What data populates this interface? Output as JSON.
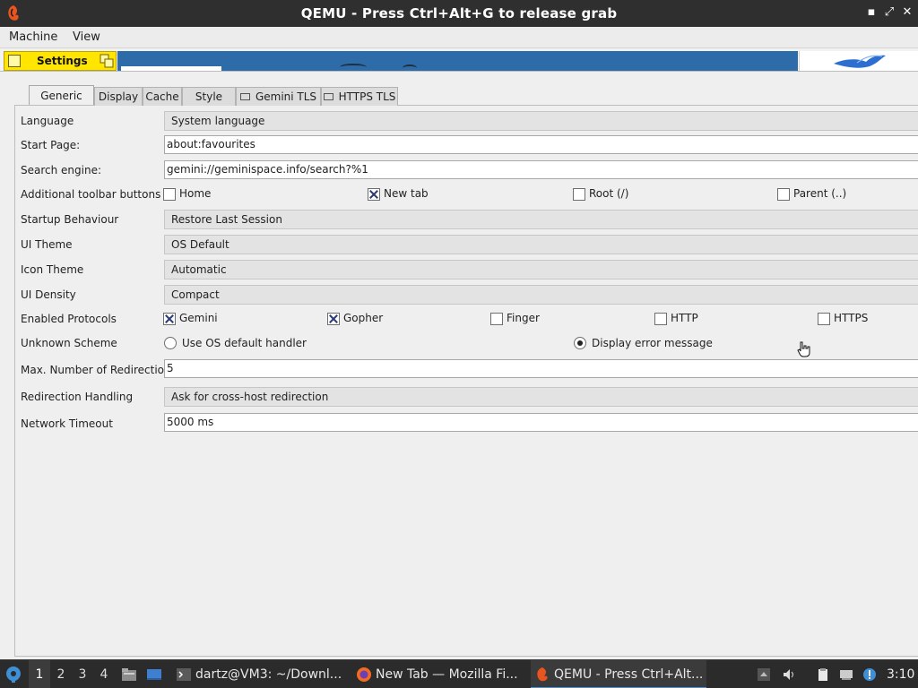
{
  "window": {
    "title": "QEMU - Press Ctrl+Alt+G to release grab",
    "minimize_glyph": "▪",
    "restore_glyph": "⤢",
    "close_glyph": "✕"
  },
  "menubar": {
    "items": [
      "Machine",
      "View"
    ]
  },
  "toolbar": {
    "settings_label": "Settings"
  },
  "tabs": [
    "Generic",
    "Display",
    "Cache",
    "Style",
    "Gemini TLS",
    "HTTPS TLS"
  ],
  "active_tab": "Generic",
  "form": {
    "language": {
      "label": "Language",
      "value": "System language"
    },
    "start_page": {
      "label": "Start Page:",
      "value": "about:favourites"
    },
    "search_engine": {
      "label": "Search engine:",
      "value": "gemini://geminispace.info/search?%1"
    },
    "toolbar_buttons": {
      "label": "Additional toolbar buttons",
      "options": [
        {
          "label": "Home",
          "checked": false
        },
        {
          "label": "New tab",
          "checked": true
        },
        {
          "label": "Root (/)",
          "checked": false
        },
        {
          "label": "Parent (..)",
          "checked": false
        }
      ]
    },
    "startup": {
      "label": "Startup Behaviour",
      "value": "Restore Last Session"
    },
    "ui_theme": {
      "label": "UI Theme",
      "value": "OS Default"
    },
    "icon_theme": {
      "label": "Icon Theme",
      "value": "Automatic"
    },
    "ui_density": {
      "label": "UI Density",
      "value": "Compact"
    },
    "protocols": {
      "label": "Enabled Protocols",
      "options": [
        {
          "label": "Gemini",
          "checked": true
        },
        {
          "label": "Gopher",
          "checked": true
        },
        {
          "label": "Finger",
          "checked": false
        },
        {
          "label": "HTTP",
          "checked": false
        },
        {
          "label": "HTTPS",
          "checked": false
        }
      ]
    },
    "unknown_scheme": {
      "label": "Unknown Scheme",
      "options": [
        {
          "label": "Use OS default handler",
          "selected": false
        },
        {
          "label": "Display error message",
          "selected": true
        }
      ]
    },
    "max_redirections": {
      "label": "Max. Number of Redirections",
      "value": "5"
    },
    "redirection_handling": {
      "label": "Redirection Handling",
      "value": "Ask for cross-host redirection"
    },
    "network_timeout": {
      "label": "Network Timeout",
      "value": "5000 ms"
    }
  },
  "taskbar": {
    "workspaces": [
      "1",
      "2",
      "3",
      "4"
    ],
    "active_workspace": "1",
    "tasks": [
      {
        "label": "dartz@VM3: ~/Downl...",
        "icon": "terminal-icon"
      },
      {
        "label": "New Tab — Mozilla Fi...",
        "icon": "firefox-icon"
      },
      {
        "label": "QEMU - Press Ctrl+Alt...",
        "icon": "qemu-icon",
        "active": true
      }
    ],
    "clock": "3:10"
  },
  "colors": {
    "titlebar": "#2f2f2f",
    "settings_tab": "#ffe500",
    "banner": "#2d6ca8",
    "taskbar": "#2b2b2b",
    "check_mark": "#2b3c77"
  }
}
